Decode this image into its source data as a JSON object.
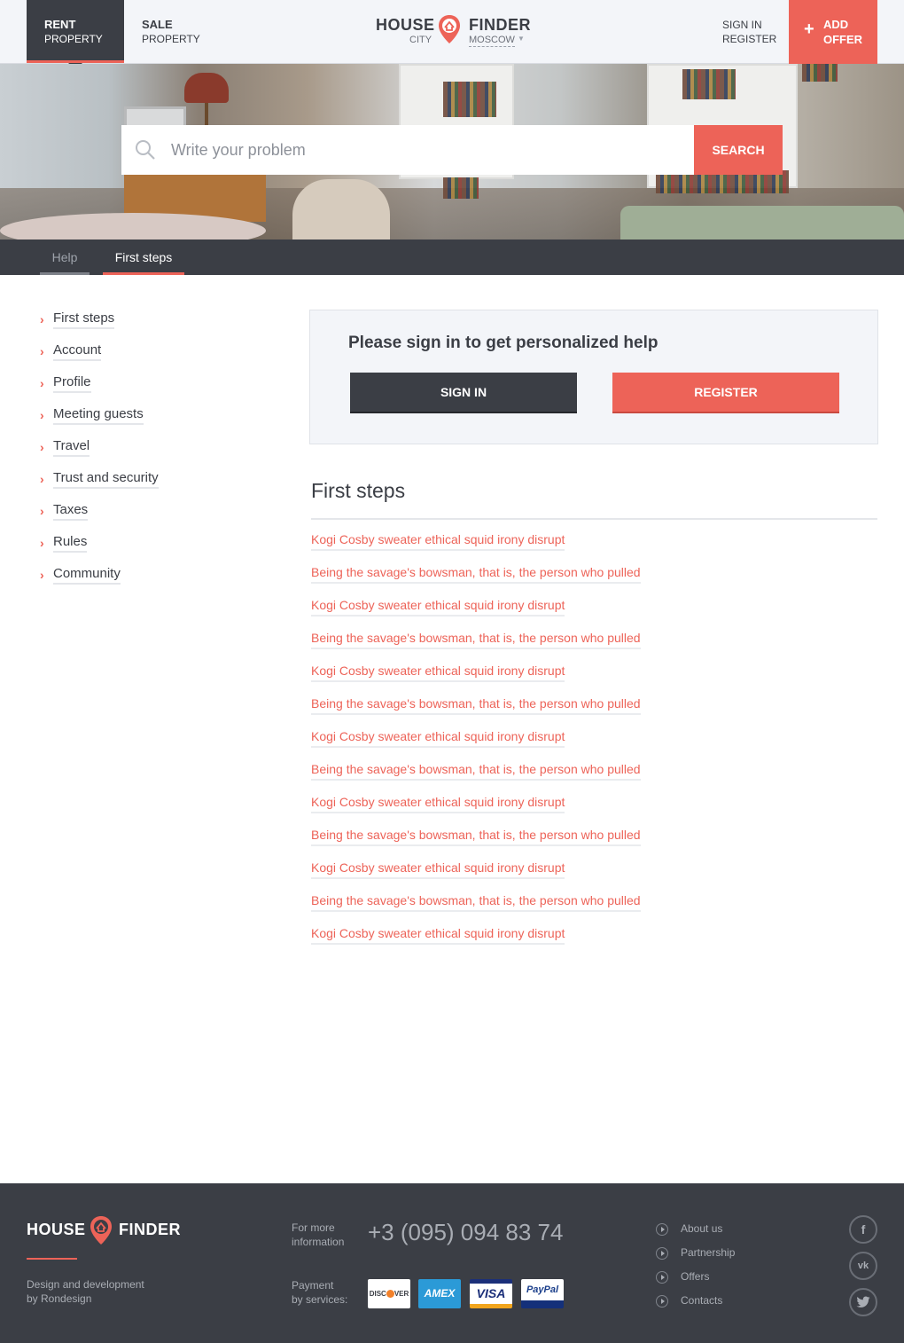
{
  "header": {
    "tabs": [
      {
        "top": "Rent",
        "bottom": "Property"
      },
      {
        "top": "Sale",
        "bottom": "Property"
      }
    ],
    "logo": {
      "word1": "HOUSE",
      "word2": "FINDER",
      "city_label": "CITY",
      "city_value": "MOSCOW"
    },
    "auth": {
      "sign_in": "SIGN IN",
      "register": "REGISTER"
    },
    "add_offer": {
      "line1": "ADD",
      "line2": "OFFER"
    }
  },
  "search": {
    "placeholder": "Write your problem",
    "button": "SEARCH"
  },
  "breadcrumb": {
    "items": [
      "Help",
      "First steps"
    ]
  },
  "sidebar": {
    "items": [
      "First steps",
      "Account",
      "Profile",
      "Meeting guests",
      "Travel",
      "Trust and security",
      "Taxes",
      "Rules",
      "Community"
    ]
  },
  "signin_panel": {
    "title": "Please sign in to get personalized help",
    "sign_in": "SIGN IN",
    "register": "REGISTER"
  },
  "section": {
    "title": "First steps",
    "links": [
      "Kogi Cosby sweater ethical squid irony disrupt",
      "Being the savage's bowsman, that is, the person who pulled",
      "Kogi Cosby sweater ethical squid irony disrupt",
      "Being the savage's bowsman, that is, the person who pulled",
      "Kogi Cosby sweater ethical squid irony disrupt",
      "Being the savage's bowsman, that is, the person who pulled",
      "Kogi Cosby sweater ethical squid irony disrupt",
      "Being the savage's bowsman, that is, the person who pulled",
      "Kogi Cosby sweater ethical squid irony disrupt",
      "Being the savage's bowsman, that is, the person who pulled",
      "Kogi Cosby sweater ethical squid irony disrupt",
      "Being the savage's bowsman, that is, the person who pulled",
      "Kogi Cosby sweater ethical squid irony disrupt"
    ]
  },
  "footer": {
    "logo": {
      "word1": "HOUSE",
      "word2": "FINDER"
    },
    "credit": {
      "line1": "Design and development",
      "line2": "by Rondesign"
    },
    "more_info": {
      "line1": "For more",
      "line2": "information"
    },
    "phone": "+3 (095) 094 83 74",
    "payment": {
      "line1": "Payment",
      "line2": "by services:"
    },
    "cards": [
      "DISCOVER",
      "AMEX",
      "VISA",
      "PayPal"
    ],
    "links": [
      "About us",
      "Partnership",
      "Offers",
      "Contacts"
    ],
    "social": [
      "facebook-icon",
      "vk-icon",
      "twitter-icon"
    ]
  },
  "colors": {
    "accent": "#ed6358",
    "dark": "#3b3e45",
    "light_bg": "#f3f5f9"
  }
}
